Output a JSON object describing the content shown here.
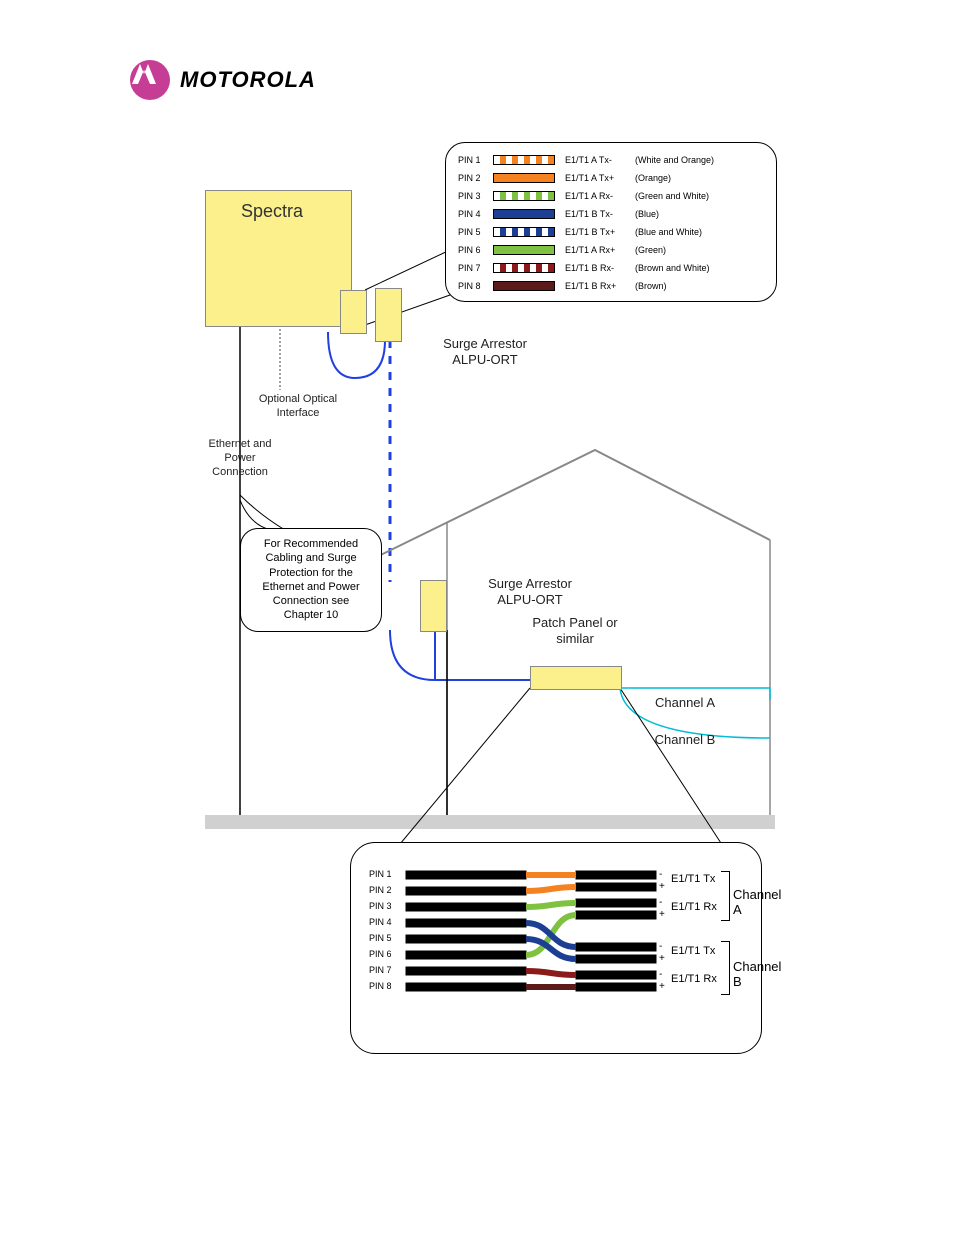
{
  "brand": "MOTOROLA",
  "diagram": {
    "main_device": "Spectra",
    "surge_label": "Surge Arrestor\nALPU-ORT",
    "optical_label": "Optional Optical\nInterface",
    "eth_power_label": "Ethernet and\nPower\nConnection",
    "recommendation": "For Recommended\nCabling and Surge\nProtection for the\nEthernet and Power\nConnection see\nChapter 10",
    "patch_label": "Patch Panel or\nsimilar",
    "channel_a": "Channel A",
    "channel_b": "Channel B"
  },
  "pin_legend": [
    {
      "pin": "PIN 1",
      "swatch": "sw-whor",
      "signal": "E1/T1 A Tx-",
      "color": "(White and Orange)"
    },
    {
      "pin": "PIN 2",
      "swatch": "sw-or",
      "signal": "E1/T1 A Tx+",
      "color": "(Orange)"
    },
    {
      "pin": "PIN 3",
      "swatch": "sw-grwh",
      "signal": "E1/T1 A Rx-",
      "color": "(Green and White)"
    },
    {
      "pin": "PIN 4",
      "swatch": "sw-bl",
      "signal": "E1/T1 B Tx-",
      "color": "(Blue)"
    },
    {
      "pin": "PIN 5",
      "swatch": "sw-blwh",
      "signal": "E1/T1 B Tx+",
      "color": "(Blue and White)"
    },
    {
      "pin": "PIN 6",
      "swatch": "sw-gr",
      "signal": "E1/T1 A Rx+",
      "color": "(Green)"
    },
    {
      "pin": "PIN 7",
      "swatch": "sw-brwh",
      "signal": "E1/T1 B Rx-",
      "color": "(Brown and White)"
    },
    {
      "pin": "PIN 8",
      "swatch": "sw-br",
      "signal": "E1/T1 B Rx+",
      "color": "(Brown)"
    }
  ],
  "bottom_legend": {
    "pins": [
      "PIN 1",
      "PIN 2",
      "PIN 3",
      "PIN 4",
      "PIN 5",
      "PIN 6",
      "PIN 7",
      "PIN 8"
    ],
    "pairs": [
      {
        "label": "E1/T1 Tx",
        "minus_pin": 1,
        "plus_pin": 2,
        "channel": "A"
      },
      {
        "label": "E1/T1 Rx",
        "minus_pin": 3,
        "plus_pin": 6,
        "channel": "A"
      },
      {
        "label": "E1/T1 Tx",
        "minus_pin": 4,
        "plus_pin": 5,
        "channel": "B"
      },
      {
        "label": "E1/T1 Rx",
        "minus_pin": 7,
        "plus_pin": 8,
        "channel": "B"
      }
    ],
    "channel_a": "Channel A",
    "channel_b": "Channel B"
  }
}
